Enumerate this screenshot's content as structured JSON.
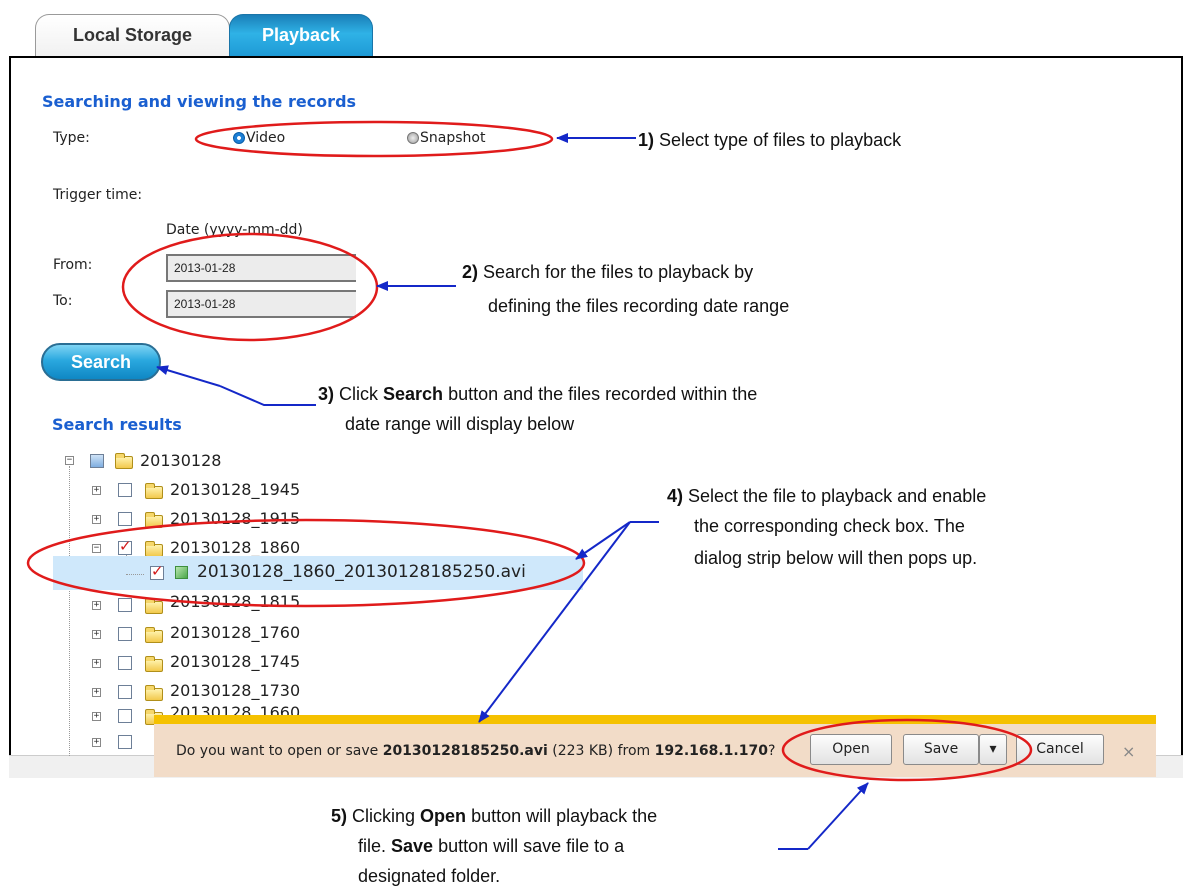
{
  "tabs": [
    {
      "label": "Local Storage",
      "active": false
    },
    {
      "label": "Playback",
      "active": true
    }
  ],
  "search_section": {
    "title": "Searching and viewing the records",
    "type_label": "Type:",
    "type_options": [
      {
        "label": "Video",
        "selected": true
      },
      {
        "label": "Snapshot",
        "selected": false
      }
    ],
    "trigger_label": "Trigger time:",
    "date_header": "Date (yyyy-mm-dd)",
    "from_label": "From:",
    "from_value": "2013-01-28",
    "to_label": "To:",
    "to_value": "2013-01-28",
    "search_button": "Search"
  },
  "results": {
    "title": "Search results",
    "root": "20130128",
    "folders": [
      {
        "name": "20130128_1945",
        "checked": false
      },
      {
        "name": "20130128_1915",
        "checked": false
      },
      {
        "name": "20130128_1860",
        "checked": true,
        "expanded": true
      },
      {
        "name": "20130128_1815",
        "checked": false
      },
      {
        "name": "20130128_1760",
        "checked": false
      },
      {
        "name": "20130128_1745",
        "checked": false
      },
      {
        "name": "20130128_1730",
        "checked": false
      },
      {
        "name": "20130128_1660",
        "checked": false
      }
    ],
    "file": {
      "name": "20130128_1860_20130128185250.avi",
      "checked": true
    }
  },
  "download_bar": {
    "prefix": "Do you want to open or save ",
    "filename": "20130128185250.avi",
    "size": " (223 KB) from ",
    "host": "192.168.1.170",
    "suffix": "?",
    "open_label": "Open",
    "save_label": "Save",
    "save_dropdown": "▾",
    "cancel_label": "Cancel",
    "close_glyph": "×"
  },
  "annotations": {
    "a1_num": "1)",
    "a1_text": " Select type of files to playback",
    "a2_num": "2)",
    "a2_line1": " Search for the files to playback by",
    "a2_line2": "defining the files recording date range",
    "a3_num": "3)",
    "a3_pre": " Click ",
    "a3_bold": "Search",
    "a3_post": " button and the files recorded within the",
    "a3_line2": "date range will display below",
    "a4_num": "4)",
    "a4_line1": " Select the file to playback and enable",
    "a4_line2": "the corresponding check box. The",
    "a4_line3": "dialog strip below will then pops up.",
    "a5_num": "5)",
    "a5_pre": " Clicking ",
    "a5_bold1": "Open",
    "a5_post1": " button will playback the",
    "a5_line2_pre": "file. ",
    "a5_bold2": "Save",
    "a5_line2_post": " button will save file to a",
    "a5_line3": "designated folder."
  },
  "colors": {
    "annotation_red": "#e01b1b",
    "arrow_blue": "#1428c8",
    "title_blue": "#1a5fd0"
  }
}
